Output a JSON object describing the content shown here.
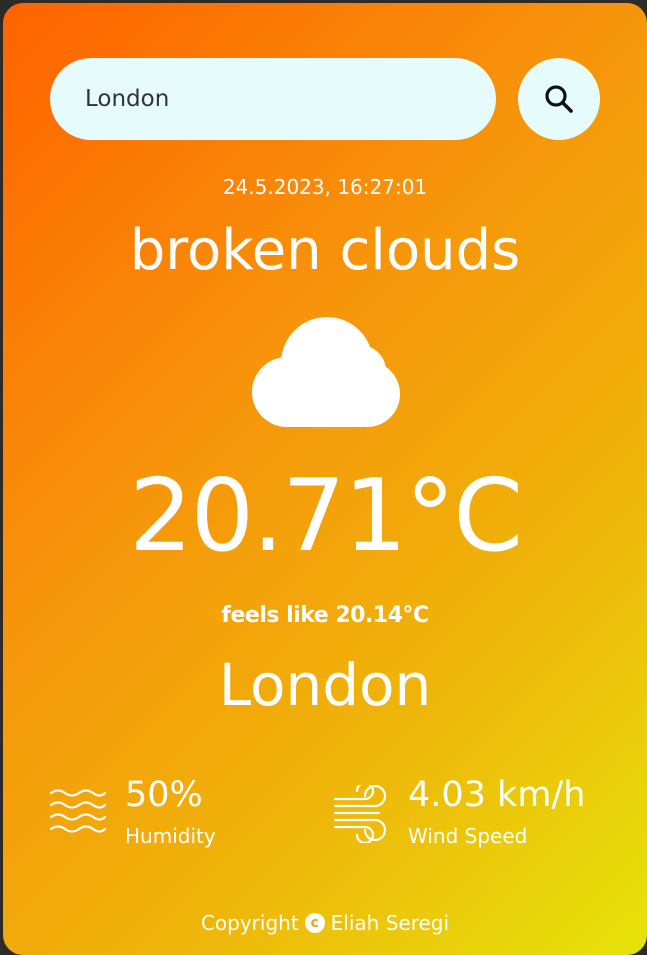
{
  "search": {
    "value": "London",
    "placeholder": ""
  },
  "datetime": "24.5.2023, 16:27:01",
  "weather": {
    "description": "broken clouds",
    "icon": "cloud-icon",
    "temperature": "20.71°C",
    "feels_like": "feels like 20.14°C",
    "city": "London"
  },
  "stats": {
    "humidity": {
      "value": "50%",
      "label": "Humidity",
      "icon": "waves-icon"
    },
    "wind": {
      "value": "4.03 km/h",
      "label": "Wind Speed",
      "icon": "wind-icon"
    }
  },
  "footer": {
    "prefix": "Copyright",
    "copyright_symbol": "c",
    "author": "Eliah Seregi"
  },
  "colors": {
    "gradient_start": "#ff6200",
    "gradient_end": "#e6e30a",
    "input_background": "#e6fcfc",
    "text": "#ffffff"
  }
}
